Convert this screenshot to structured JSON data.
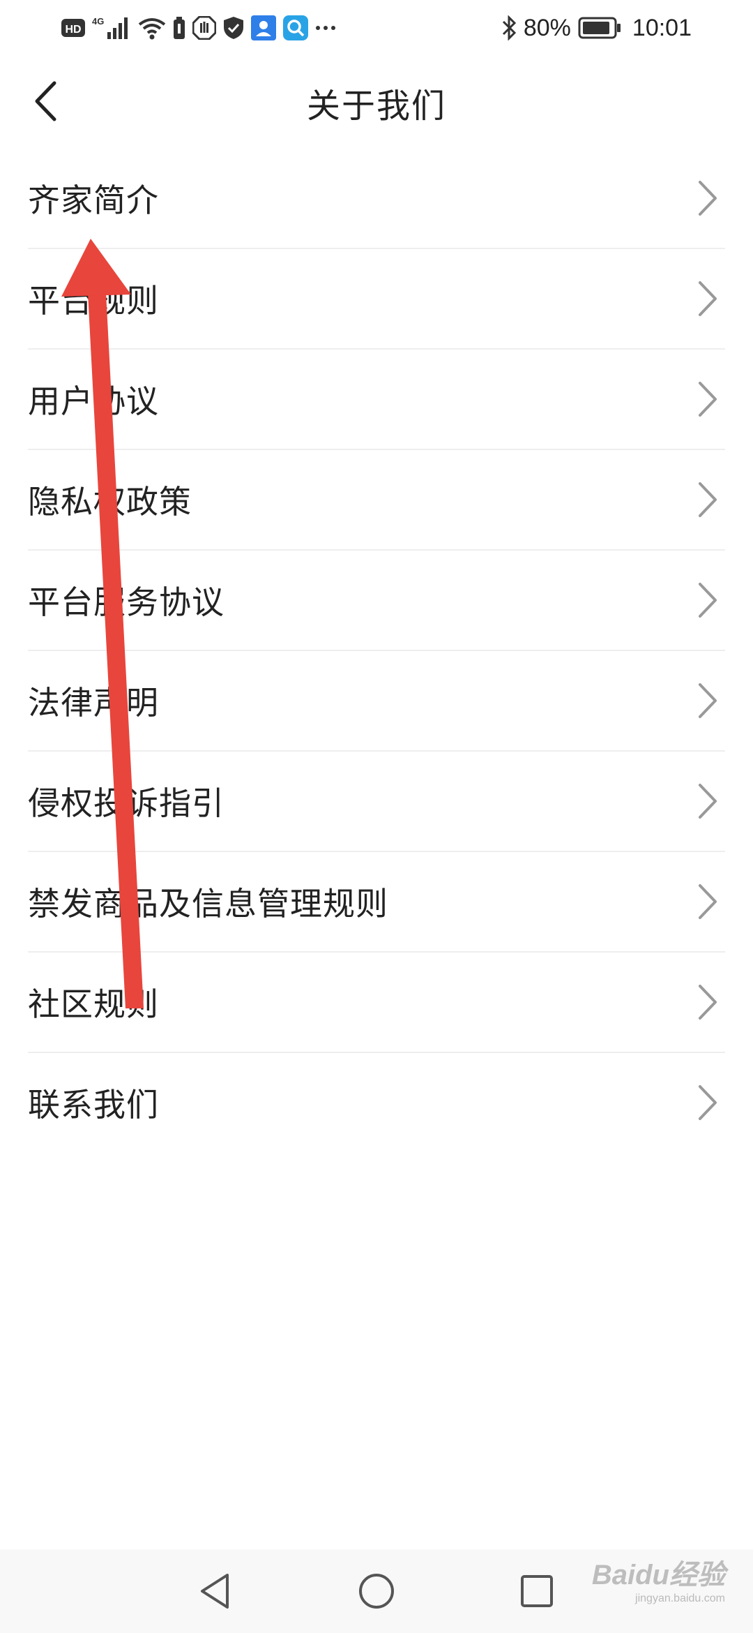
{
  "status_bar": {
    "battery_percent": "80%",
    "time": "10:01",
    "network_label": "4G",
    "hd_label": "HD",
    "icons": [
      "hd-icon",
      "signal-4g-icon",
      "wifi-icon",
      "battery-saver-icon",
      "app-hand-icon",
      "shield-icon",
      "contacts-app-icon",
      "search-app-icon",
      "more-dots-icon",
      "bluetooth-icon",
      "battery-icon"
    ]
  },
  "header": {
    "title": "关于我们",
    "back_icon": "chevron-left-icon"
  },
  "menu": {
    "items": [
      {
        "label": "齐家简介"
      },
      {
        "label": "平台规则"
      },
      {
        "label": "用户协议"
      },
      {
        "label": "隐私权政策"
      },
      {
        "label": "平台服务协议"
      },
      {
        "label": "法律声明"
      },
      {
        "label": "侵权投诉指引"
      },
      {
        "label": "禁发商品及信息管理规则"
      },
      {
        "label": "社区规则"
      },
      {
        "label": "联系我们"
      }
    ],
    "chevron_icon": "chevron-right-icon"
  },
  "annotation": {
    "color": "#e8453c",
    "icon": "red-arrow-up-icon"
  },
  "nav_bar": {
    "buttons": [
      "nav-back-icon",
      "nav-home-icon",
      "nav-recent-icon"
    ]
  },
  "watermark": {
    "text": "Baidu经验",
    "subtext": "jingyan.baidu.com"
  },
  "colors": {
    "text": "#222222",
    "divider": "#eeeeee",
    "chevron": "#999999",
    "accent_red": "#e8453c",
    "app_blue": "#2f7fe8"
  }
}
